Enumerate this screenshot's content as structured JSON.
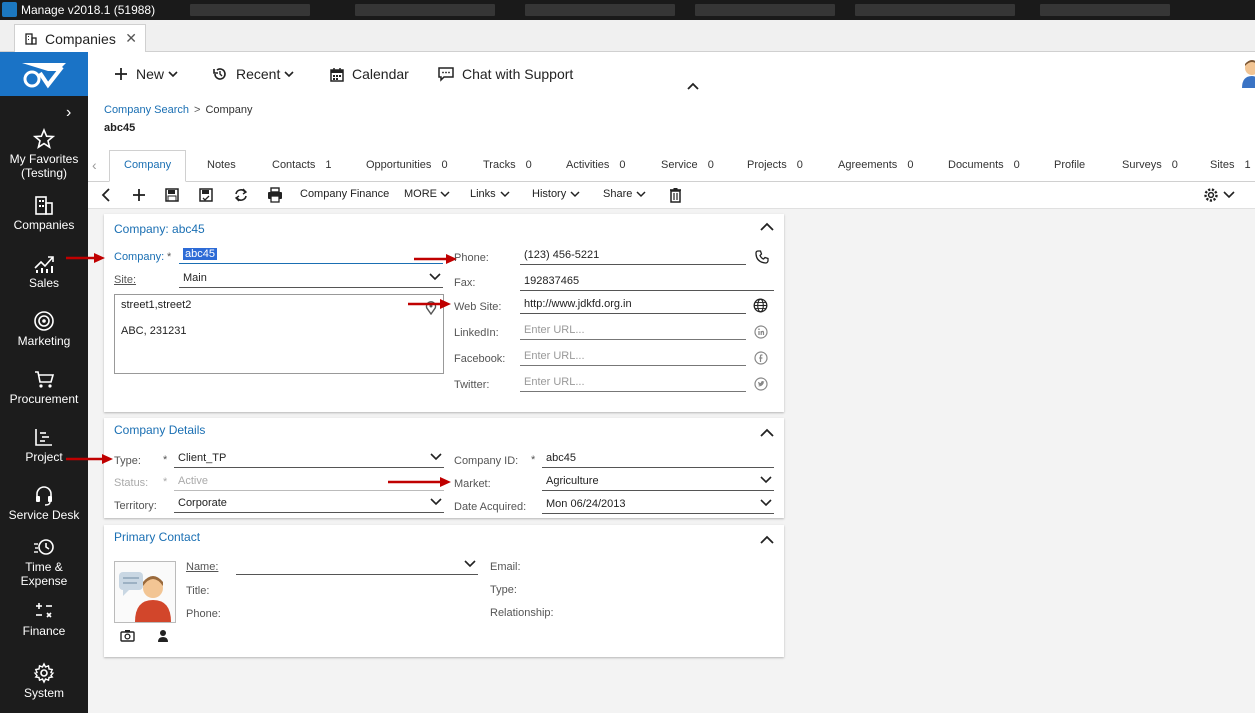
{
  "window": {
    "title": "Manage v2018.1 (51988)"
  },
  "browser_tab": {
    "label": "Companies",
    "close_glyph": "✕"
  },
  "sidebar": {
    "items": [
      {
        "label_line1": "My Favorites",
        "label_line2": "(Testing)",
        "icon": "star-icon"
      },
      {
        "label": "Companies",
        "icon": "building-icon"
      },
      {
        "label": "Sales",
        "icon": "sales-chart-icon"
      },
      {
        "label": "Marketing",
        "icon": "target-icon"
      },
      {
        "label": "Procurement",
        "icon": "cart-icon"
      },
      {
        "label": "Project",
        "icon": "project-icon"
      },
      {
        "label": "Service Desk",
        "icon": "headset-icon"
      },
      {
        "label_line1": "Time &",
        "label_line2": "Expense",
        "icon": "time-expense-icon"
      },
      {
        "label": "Finance",
        "icon": "finance-icon"
      },
      {
        "label": "System",
        "icon": "gear-icon"
      }
    ]
  },
  "toolbar": {
    "new_label": "New",
    "recent_label": "Recent",
    "calendar_label": "Calendar",
    "chat_label": "Chat with Support"
  },
  "breadcrumb": {
    "parent": "Company Search",
    "separator": ">",
    "current": "Company"
  },
  "record": {
    "name": "abc45"
  },
  "record_tabs": [
    {
      "label": "Company",
      "count": ""
    },
    {
      "label": "Notes",
      "count": ""
    },
    {
      "label": "Contacts",
      "count": "1"
    },
    {
      "label": "Opportunities",
      "count": "0"
    },
    {
      "label": "Tracks",
      "count": "0"
    },
    {
      "label": "Activities",
      "count": "0"
    },
    {
      "label": "Service",
      "count": "0"
    },
    {
      "label": "Projects",
      "count": "0"
    },
    {
      "label": "Agreements",
      "count": "0"
    },
    {
      "label": "Documents",
      "count": "0"
    },
    {
      "label": "Profile",
      "count": ""
    },
    {
      "label": "Surveys",
      "count": "0"
    },
    {
      "label": "Sites",
      "count": "1"
    }
  ],
  "actions": {
    "company_finance": "Company Finance",
    "more": "MORE",
    "links": "Links",
    "history": "History",
    "share": "Share"
  },
  "company_panel": {
    "title": "Company: abc45",
    "company_label": "Company:",
    "required_mark": "*",
    "company_value": "abc45",
    "site_label": "Site:",
    "site_value": "Main",
    "address_line1": "street1,street2",
    "address_line2": "ABC, 231231",
    "phone_label": "Phone:",
    "phone_value": "(123) 456-5221",
    "fax_label": "Fax:",
    "fax_value": "192837465",
    "website_label": "Web Site:",
    "website_value": "http://www.jdkfd.org.in",
    "linkedin_label": "LinkedIn:",
    "facebook_label": "Facebook:",
    "twitter_label": "Twitter:",
    "url_placeholder": "Enter URL..."
  },
  "details_panel": {
    "title": "Company Details",
    "type_label": "Type:",
    "type_value": "Client_TP",
    "status_label": "Status:",
    "status_value": "Active",
    "territory_label": "Territory:",
    "territory_value": "Corporate",
    "company_id_label": "Company ID:",
    "company_id_value": "abc45",
    "market_label": "Market:",
    "market_value": "Agriculture",
    "date_acquired_label": "Date Acquired:",
    "date_acquired_value": "Mon 06/24/2013"
  },
  "contact_panel": {
    "title": "Primary Contact",
    "name_label": "Name:",
    "title_label": "Title:",
    "phone_label": "Phone:",
    "email_label": "Email:",
    "type_label": "Type:",
    "relationship_label": "Relationship:"
  },
  "colors": {
    "accent": "#1a6fb3",
    "sidebar_bg": "#1c1c1c",
    "logo_bg": "#1a73c6",
    "annotation_arrow": "#c00000",
    "selection": "#2d6bd6"
  }
}
